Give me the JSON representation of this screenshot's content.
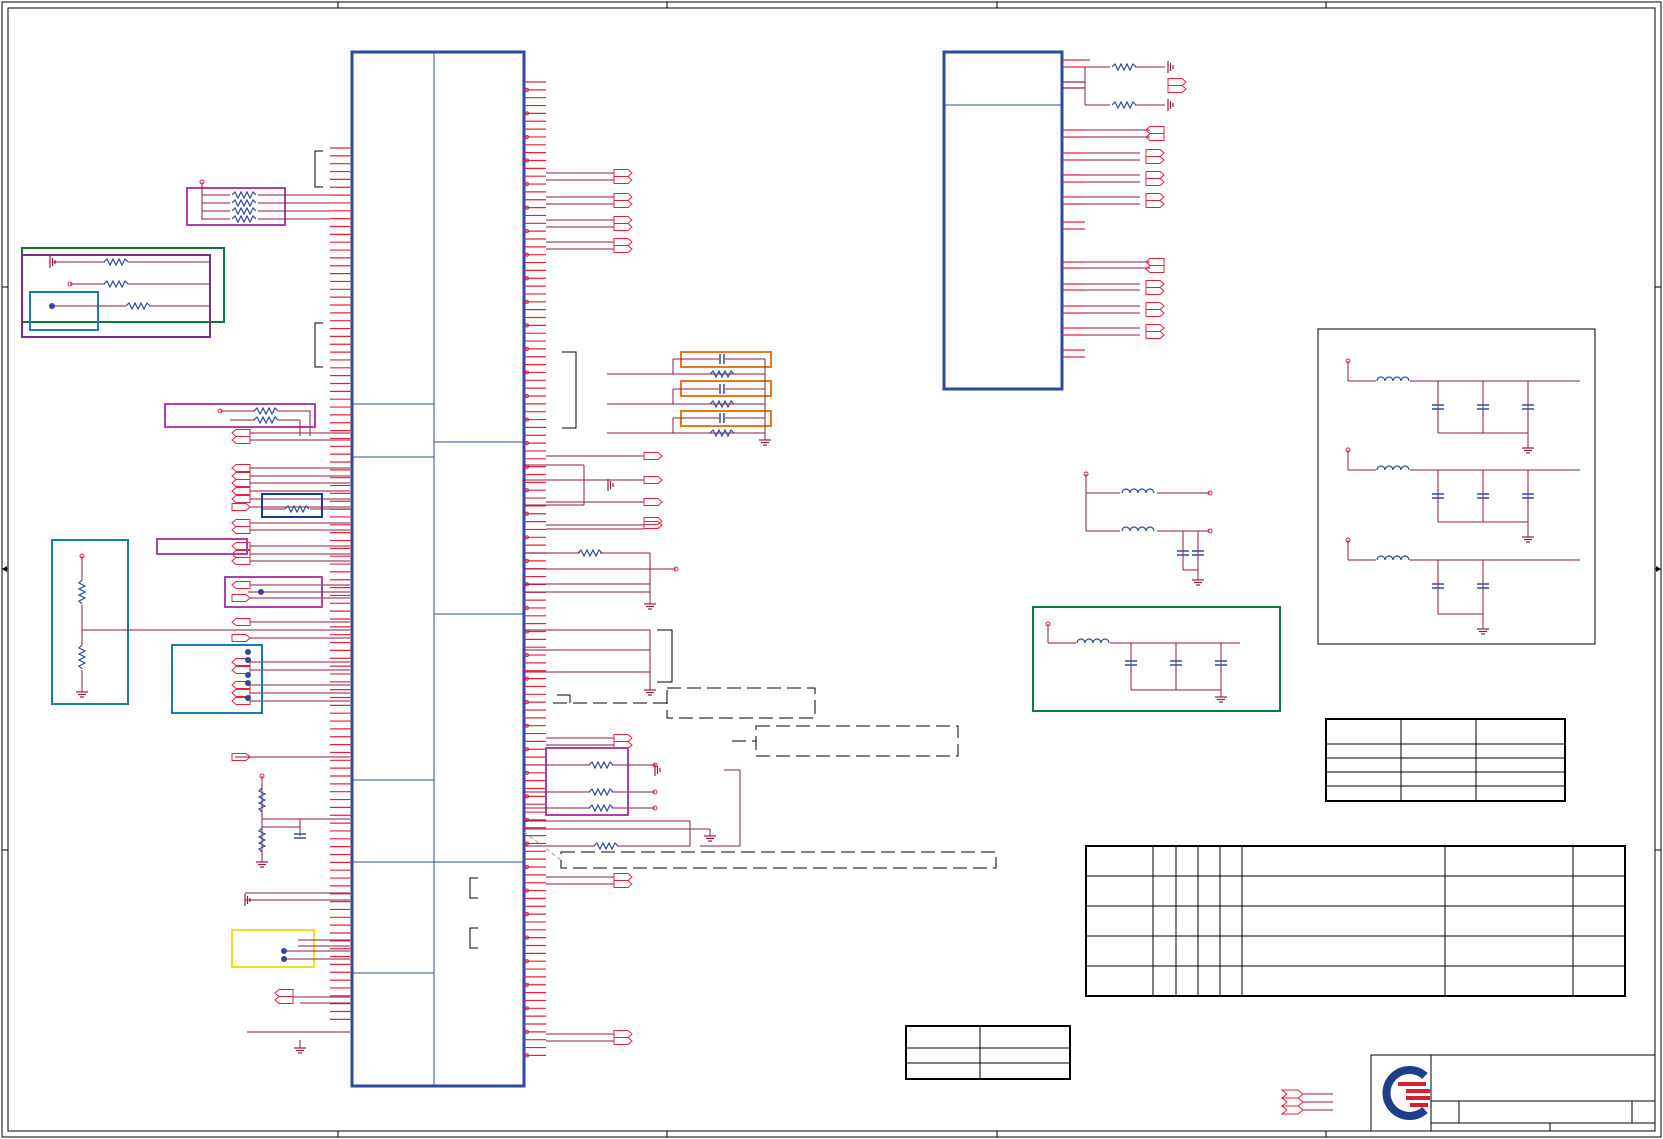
{
  "colors": {
    "frame": "#000000",
    "ic_body": "#2E4A9E",
    "net_wire": "#8B1A4A",
    "pin": "#E8203C",
    "component_passive": "#2E4A9E",
    "highlight_green": "#0E7A3A",
    "highlight_purple": "#7B2A8C",
    "highlight_magenta": "#B040A8",
    "highlight_blue": "#1A7AB8",
    "highlight_orange": "#E8781E",
    "highlight_yellow": "#F0E020",
    "highlight_navy": "#1A3A9E",
    "logo_blue": "#1E3E8C",
    "logo_red": "#D8202C"
  },
  "drawing": {
    "sheet_name": "",
    "logo": "company-logo"
  }
}
